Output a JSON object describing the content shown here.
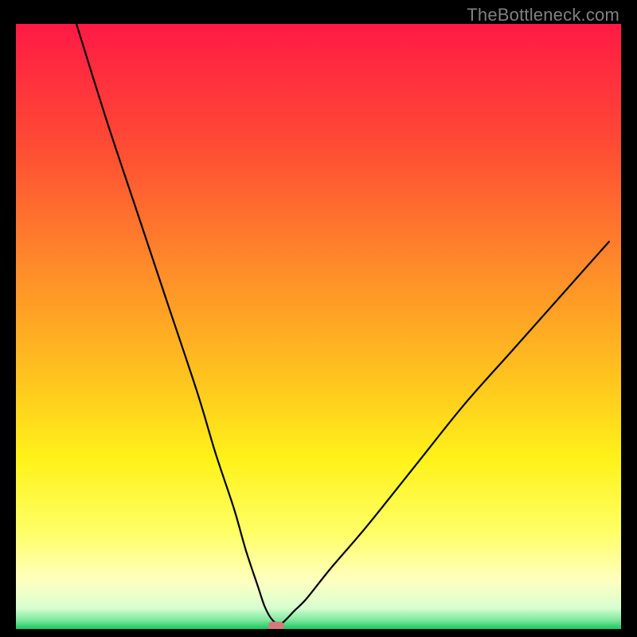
{
  "watermark": {
    "text": "TheBottleneck.com"
  },
  "chart_data": {
    "type": "line",
    "title": "",
    "xlabel": "",
    "ylabel": "",
    "xlim": [
      0,
      100
    ],
    "ylim": [
      0,
      100
    ],
    "series": [
      {
        "name": "bottleneck-curve",
        "x": [
          10,
          15,
          20,
          25,
          30,
          33,
          36,
          38,
          40,
          41,
          42,
          43,
          44,
          46,
          48,
          52,
          58,
          66,
          74,
          82,
          90,
          98
        ],
        "y": [
          100,
          84,
          69,
          54,
          39,
          29,
          20,
          13,
          7,
          4,
          2,
          1,
          1,
          3,
          5,
          10,
          17,
          27,
          37,
          46,
          55,
          64
        ]
      }
    ],
    "annotations": [
      {
        "name": "optimal-marker",
        "x": 43,
        "y": 0.5
      }
    ],
    "gradient_stops": [
      {
        "offset": 0.0,
        "color": "#ff1a45"
      },
      {
        "offset": 0.2,
        "color": "#ff4b34"
      },
      {
        "offset": 0.4,
        "color": "#ff8a2a"
      },
      {
        "offset": 0.58,
        "color": "#ffc21f"
      },
      {
        "offset": 0.72,
        "color": "#fff21a"
      },
      {
        "offset": 0.84,
        "color": "#ffff66"
      },
      {
        "offset": 0.92,
        "color": "#ffffc0"
      },
      {
        "offset": 0.965,
        "color": "#d8ffd0"
      },
      {
        "offset": 0.985,
        "color": "#7fe8a0"
      },
      {
        "offset": 1.0,
        "color": "#18c760"
      }
    ]
  }
}
